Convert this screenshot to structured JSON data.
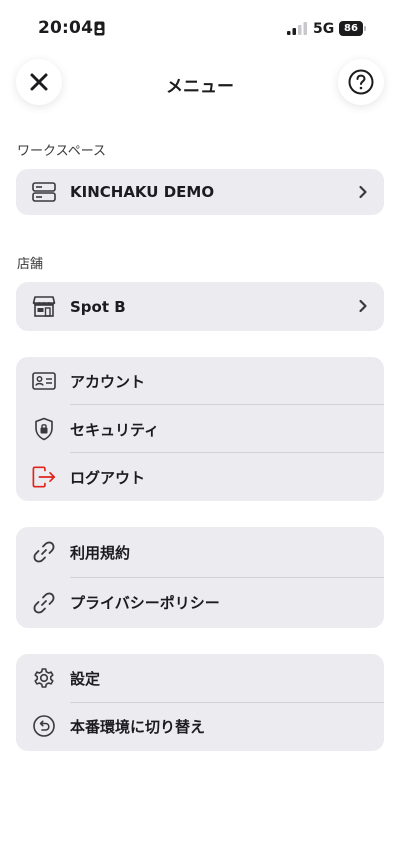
{
  "status": {
    "time": "20:04",
    "network": "5G",
    "battery": "86"
  },
  "header": {
    "title": "メニュー"
  },
  "workspace": {
    "section_label": "ワークスペース",
    "name": "KINCHAKU DEMO"
  },
  "store": {
    "section_label": "店舗",
    "name": "Spot B"
  },
  "account_group": {
    "items": [
      {
        "label": "アカウント"
      },
      {
        "label": "セキュリティ"
      },
      {
        "label": "ログアウト"
      }
    ]
  },
  "legal_group": {
    "items": [
      {
        "label": "利用規約"
      },
      {
        "label": "プライバシーポリシー"
      }
    ]
  },
  "settings_group": {
    "items": [
      {
        "label": "設定"
      },
      {
        "label": "本番環境に切り替え"
      }
    ]
  },
  "colors": {
    "logout_icon": "#e0241b",
    "card_bg": "#ebebf0"
  }
}
